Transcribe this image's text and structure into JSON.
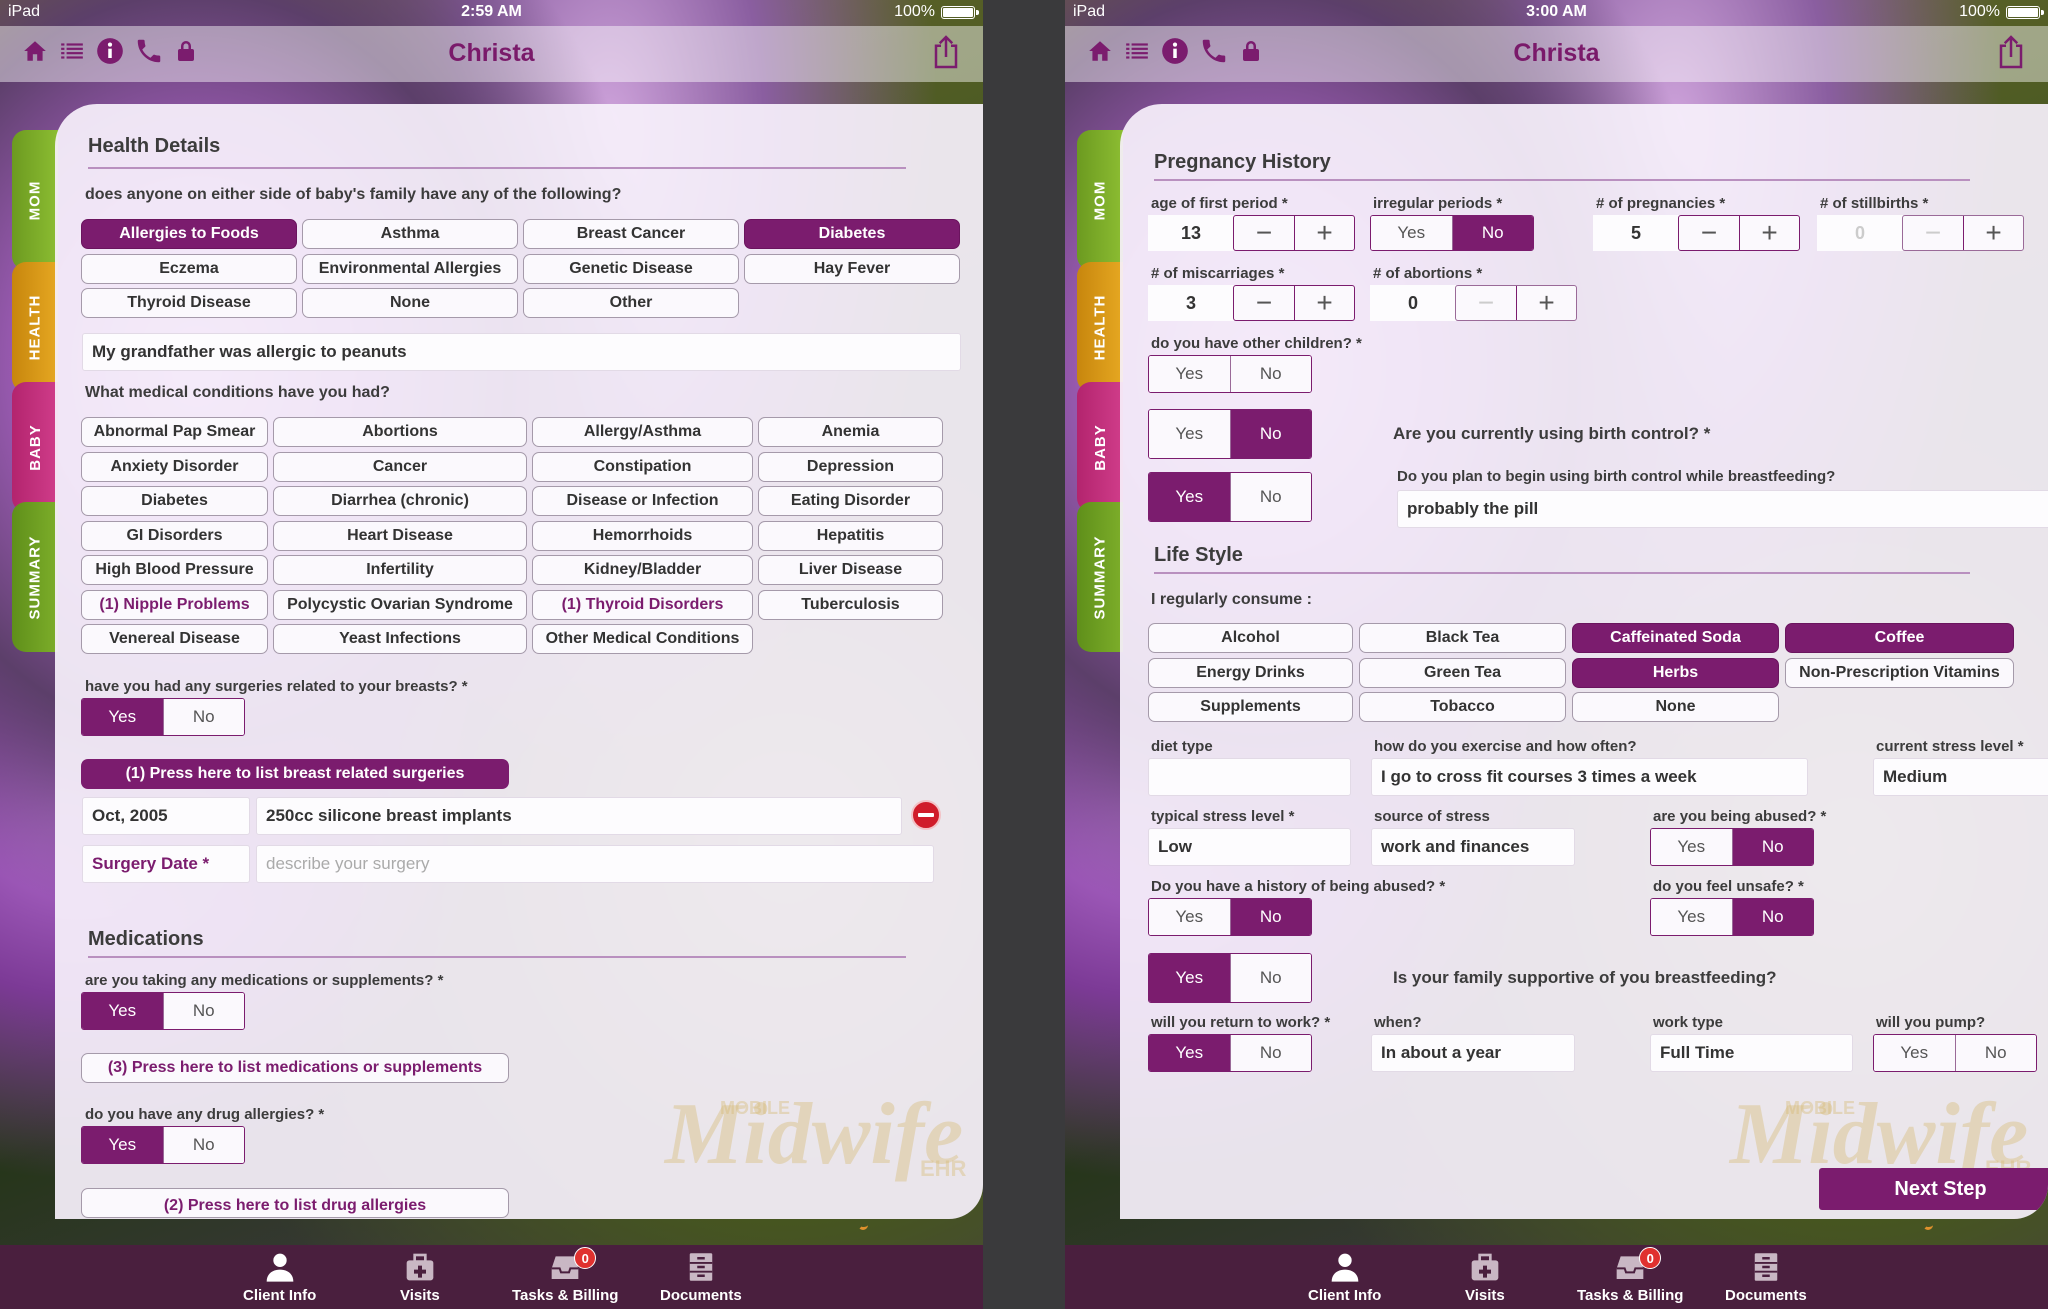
{
  "screen1": {
    "status": {
      "carrier": "iPad",
      "time": "2:59 AM",
      "battery": "100%"
    },
    "nav": {
      "title": "Christa"
    },
    "tabs": [
      "MOM",
      "HEALTH",
      "BABY",
      "SUMMARY"
    ],
    "health": {
      "title": "Health Details",
      "family_q": "does anyone on either side of baby's family have any of the following?",
      "family_opts": [
        {
          "label": "Allergies to Foods",
          "sel": true
        },
        {
          "label": "Asthma",
          "sel": false
        },
        {
          "label": "Breast Cancer",
          "sel": false
        },
        {
          "label": "Diabetes",
          "sel": true
        },
        {
          "label": "Eczema",
          "sel": false
        },
        {
          "label": "Environmental Allergies",
          "sel": false
        },
        {
          "label": "Genetic Disease",
          "sel": false
        },
        {
          "label": "Hay Fever",
          "sel": false
        },
        {
          "label": "Thyroid Disease",
          "sel": false
        },
        {
          "label": "None",
          "sel": false
        },
        {
          "label": "Other",
          "sel": false
        }
      ],
      "family_note": "My grandfather was allergic to peanuts",
      "cond_q": "What medical conditions have you had?",
      "conds": [
        "Abnormal Pap Smear",
        "Abortions",
        "Allergy/Asthma",
        "Anemia",
        "Anxiety Disorder",
        "Cancer",
        "Constipation",
        "Depression",
        "Diabetes",
        "Diarrhea (chronic)",
        "Disease or Infection",
        "Eating Disorder",
        "GI Disorders",
        "Heart Disease",
        "Hemorrhoids",
        "Hepatitis",
        "High Blood Pressure",
        "Infertility",
        "Kidney/Bladder",
        "Liver Disease",
        "(1) Nipple Problems",
        "Polycystic Ovarian Syndrome",
        "(1) Thyroid Disorders",
        "Tuberculosis",
        "Venereal Disease",
        "Yeast Infections",
        "Other Medical Conditions"
      ],
      "surg_q": "have you had any surgeries related to your breasts? *",
      "surg_btn": "(1) Press here to list breast related surgeries",
      "surg_date": "Oct, 2005",
      "surg_desc": "250cc silicone breast implants",
      "surg_date_label": "Surgery Date *",
      "surg_desc_ph": "describe your surgery"
    },
    "meds": {
      "title": "Medications",
      "q": "are you taking any medications or supplements? *",
      "btn": "(3) Press here to list medications or supplements",
      "allergy_q": "do you have any drug allergies? *",
      "allergy_btn": "(2) Press here to list drug allergies"
    },
    "yes": "Yes",
    "no": "No"
  },
  "screen2": {
    "status": {
      "carrier": "iPad",
      "time": "3:00 AM",
      "battery": "100%"
    },
    "nav": {
      "title": "Christa"
    },
    "preg": {
      "title": "Pregnancy History",
      "age_first_label": "age of first period *",
      "age_first": "13",
      "irregular_label": "irregular periods *",
      "pregnancies_label": "# of pregnancies *",
      "pregnancies": "5",
      "stillbirths_label": "# of stillbirths *",
      "stillbirths": "0",
      "miscarriages_label": "# of miscarriages *",
      "miscarriages": "3",
      "abortions_label": "# of abortions *",
      "abortions": "0",
      "other_children_q": "do you have other children? *",
      "birth_control_q": "Are you currently using birth control? *",
      "bc_breastfeed_q": "Do you plan to begin using birth control while breastfeeding?",
      "bc_plan": "probably the pill"
    },
    "life": {
      "title": "Life Style",
      "consume_q": "I regularly consume :",
      "consume": [
        {
          "label": "Alcohol",
          "sel": false
        },
        {
          "label": "Black Tea",
          "sel": false
        },
        {
          "label": "Caffeinated Soda",
          "sel": true
        },
        {
          "label": "Coffee",
          "sel": true
        },
        {
          "label": "Energy Drinks",
          "sel": false
        },
        {
          "label": "Green Tea",
          "sel": false
        },
        {
          "label": "Herbs",
          "sel": true
        },
        {
          "label": "Non-Prescription Vitamins",
          "sel": false
        },
        {
          "label": "Supplements",
          "sel": false
        },
        {
          "label": "Tobacco",
          "sel": false
        },
        {
          "label": "None",
          "sel": false
        }
      ],
      "diet_label": "diet type",
      "diet": "",
      "exercise_label": "how do you exercise and how often?",
      "exercise": "I go to cross fit courses 3 times a week",
      "stress_now_label": "current stress level *",
      "stress_now": "Medium",
      "stress_typ_label": "typical stress level *",
      "stress_typ": "Low",
      "stress_src_label": "source of stress",
      "stress_src": "work and finances",
      "abused_q": "are you being abused? *",
      "abuse_hist_q": "Do you have a history of being abused? *",
      "unsafe_q": "do you feel unsafe? *",
      "family_support_q": "Is your family supportive of you breastfeeding?",
      "return_work_q": "will you return to work? *",
      "when_label": "when?",
      "when": "In about a year",
      "work_type_label": "work type",
      "work_type": "Full Time",
      "pump_q": "will you pump?"
    },
    "next": "Next Step",
    "yes": "Yes",
    "no": "No"
  },
  "watermark": {
    "mobile": "MOBILE",
    "word": "Midwife",
    "ehr": "EHR"
  },
  "tabbar": {
    "client": "Client Info",
    "visits": "Visits",
    "tasks": "Tasks & Billing",
    "tasks_badge": "0",
    "docs": "Documents"
  },
  "colors": {
    "accent": "#7b1c6e",
    "title": "#7a1a6a",
    "tab_mom": "#8cbd32",
    "tab_health": "#e6a822",
    "tab_baby": "#d03d8a",
    "tab_summary": "#7dae2a"
  }
}
